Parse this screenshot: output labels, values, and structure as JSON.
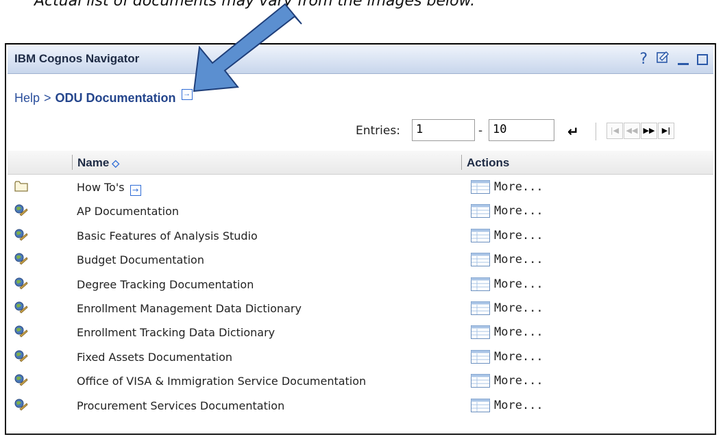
{
  "caption": "Actual list of documents may vary from the images below.",
  "portlet": {
    "title": "IBM Cognos Navigator",
    "icons": [
      "help-icon",
      "properties-icon",
      "minimize-icon",
      "maximize-icon"
    ],
    "help_glyph": "?"
  },
  "breadcrumb": {
    "root": "Help",
    "separator": ">",
    "current": "ODU Documentation"
  },
  "entries": {
    "label": "Entries:",
    "from": "1",
    "dash": "-",
    "to": "10"
  },
  "columns": {
    "name": "Name",
    "actions": "Actions"
  },
  "rows": [
    {
      "name": "How To's",
      "type": "folder",
      "action": "More..."
    },
    {
      "name": "AP Documentation",
      "type": "url",
      "action": "More..."
    },
    {
      "name": "Basic Features of Analysis Studio",
      "type": "url",
      "action": "More..."
    },
    {
      "name": "Budget Documentation",
      "type": "url",
      "action": "More..."
    },
    {
      "name": "Degree Tracking Documentation",
      "type": "url",
      "action": "More..."
    },
    {
      "name": "Enrollment Management Data Dictionary",
      "type": "url",
      "action": "More..."
    },
    {
      "name": "Enrollment Tracking Data Dictionary",
      "type": "url",
      "action": "More..."
    },
    {
      "name": "Fixed Assets Documentation",
      "type": "url",
      "action": "More..."
    },
    {
      "name": "Office of VISA & Immigration Service Documentation",
      "type": "url",
      "action": "More..."
    },
    {
      "name": "Procurement Services Documentation",
      "type": "url",
      "action": "More..."
    }
  ],
  "colors": {
    "title_text": "#1e2b45",
    "link_blue": "#2b4f9c",
    "arrow": "#5b8fd0"
  }
}
